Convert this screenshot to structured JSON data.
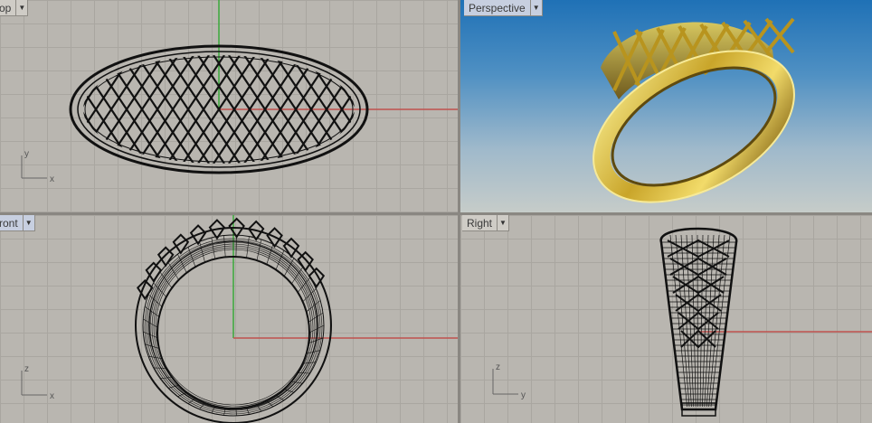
{
  "viewports": {
    "top": {
      "label": "op",
      "dropdown_icon": "chevron-down-icon",
      "axis": {
        "v": "y",
        "h": "x"
      }
    },
    "perspective": {
      "label": "Perspective",
      "dropdown_icon": "chevron-down-icon"
    },
    "front": {
      "label": "ront",
      "dropdown_icon": "chevron-down-icon",
      "axis": {
        "v": "z",
        "h": "x"
      }
    },
    "right": {
      "label": "Right",
      "dropdown_icon": "chevron-down-icon",
      "axis": {
        "v": "z",
        "h": "y"
      }
    }
  },
  "colors": {
    "grid_bg": "#b9b6b0",
    "x_axis": "#c0504d",
    "y_axis": "#3aa83a",
    "wireframe": "#111111",
    "gold_light": "#f2e07a",
    "gold_dark": "#8a6a10",
    "sky_top": "#1f71b6",
    "active_tab": "#c7cfe0"
  }
}
